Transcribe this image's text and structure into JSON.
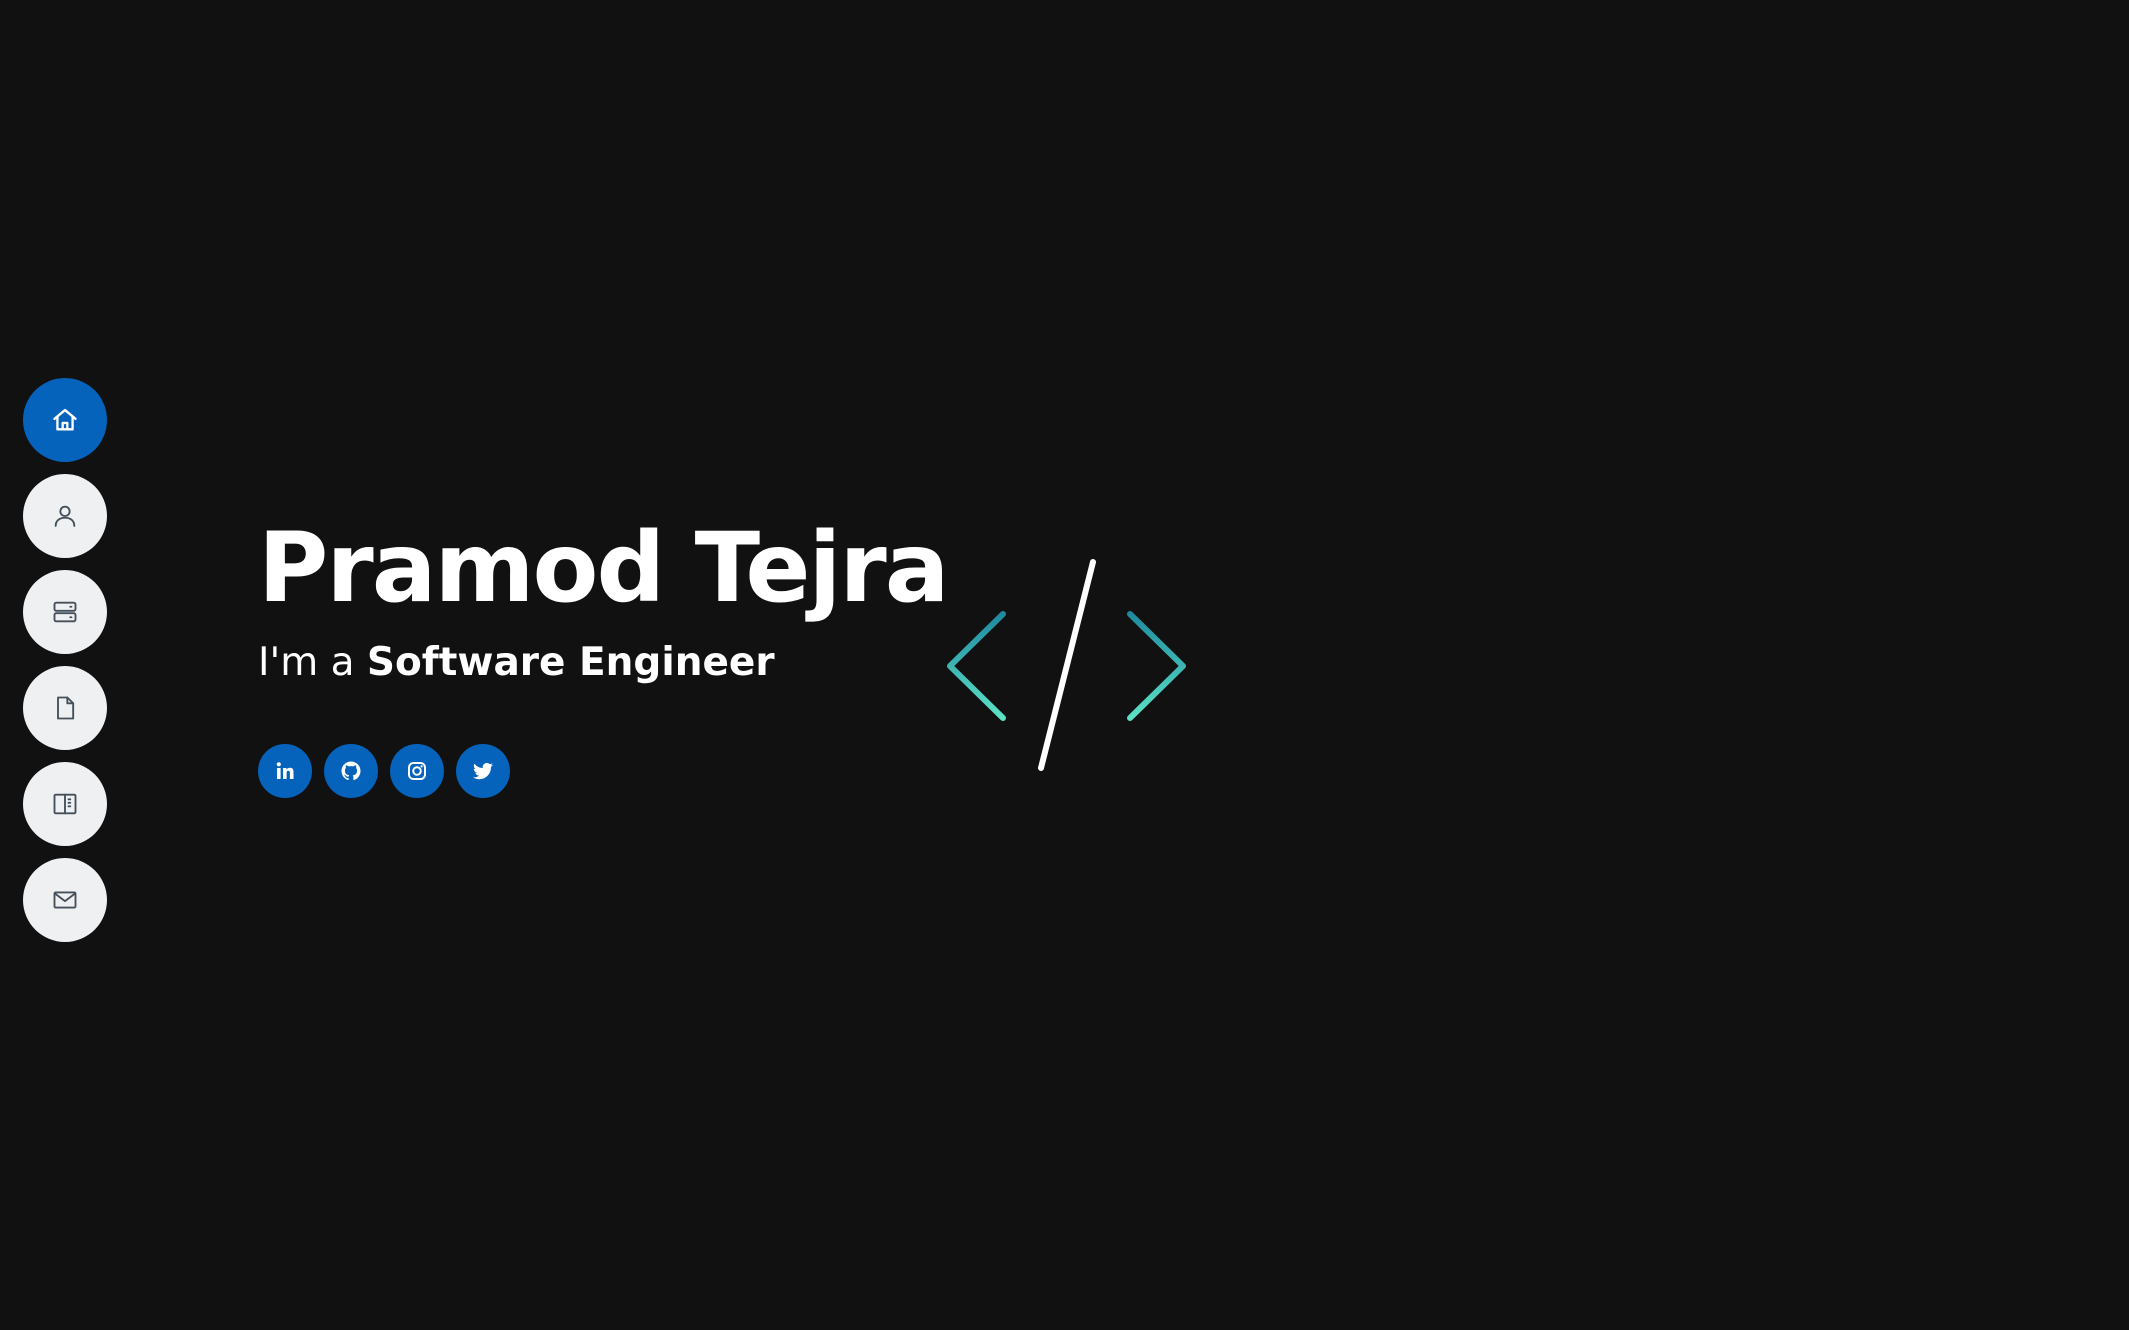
{
  "hero": {
    "name": "Pramod Tejra",
    "subtitle_prefix": "I'm a",
    "role": "Software Engineer"
  },
  "sidebar": {
    "items": [
      {
        "icon": "home-icon",
        "active": true
      },
      {
        "icon": "user-icon",
        "active": false
      },
      {
        "icon": "server-icon",
        "active": false
      },
      {
        "icon": "file-icon",
        "active": false
      },
      {
        "icon": "book-icon",
        "active": false
      },
      {
        "icon": "mail-icon",
        "active": false
      }
    ]
  },
  "socials": [
    "linkedin-icon",
    "github-icon",
    "instagram-icon",
    "twitter-icon"
  ],
  "colors": {
    "background": "#111111",
    "accent": "#0563bb",
    "nav_inactive": "#eef0f2",
    "logo_gradient_start": "#1f8a9f",
    "logo_gradient_end": "#5ce1c6"
  }
}
